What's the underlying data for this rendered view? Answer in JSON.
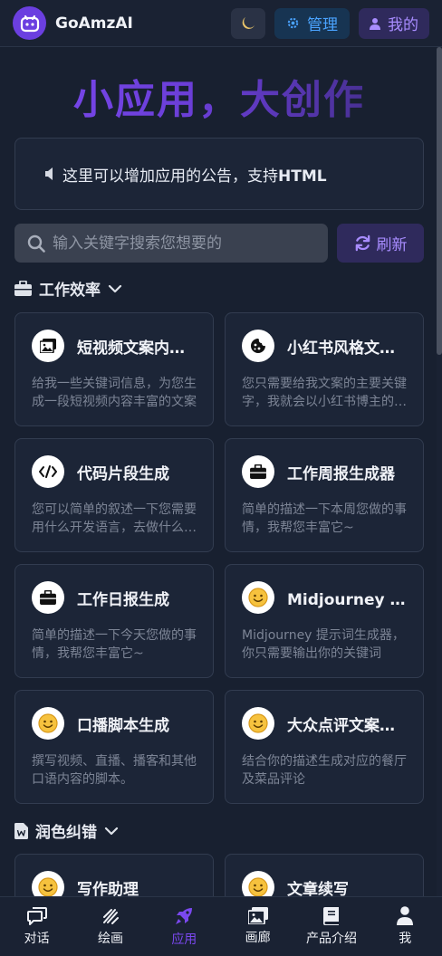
{
  "header": {
    "brand": "GoAmzAI",
    "admin_label": "管理",
    "me_label": "我的"
  },
  "hero_title": "小应用，大创作",
  "notice": {
    "text": "这里可以增加应用的公告，支持",
    "emphasis": "HTML"
  },
  "search": {
    "placeholder": "输入关键字搜索您想要的"
  },
  "refresh_label": "刷新",
  "sections": [
    {
      "title": "工作效率",
      "apps": [
        {
          "title": "短视频文案内容生成",
          "desc": "给我一些关键词信息，为您生成一段短视频内容丰富的文案",
          "icon": "image-icon"
        },
        {
          "title": "小红书风格文案生成",
          "desc": "您只需要给我文案的主要关键字，我就会以小红书博主的风格为您生成",
          "icon": "cookie-icon"
        },
        {
          "title": "代码片段生成",
          "desc": "您可以简单的叙述一下您需要用什么开发语言，去做什么事情",
          "icon": "code-icon"
        },
        {
          "title": "工作周报生成器",
          "desc": "简单的描述一下本周您做的事情，我帮您丰富它~",
          "icon": "briefcase-icon"
        },
        {
          "title": "工作日报生成",
          "desc": "简单的描述一下今天您做的事情，我帮您丰富它~",
          "icon": "briefcase-icon"
        },
        {
          "title": "Midjourney 提示词生成器",
          "desc": "Midjourney 提示词生成器，你只需要输出你的关键词",
          "icon": "smile-icon"
        },
        {
          "title": "口播脚本生成",
          "desc": "撰写视频、直播、播客和其他口语内容的脚本。",
          "icon": "smile-icon"
        },
        {
          "title": "大众点评文案生成",
          "desc": "结合你的描述生成对应的餐厅及菜品评论",
          "icon": "smile-icon"
        }
      ]
    },
    {
      "title": "润色纠错",
      "apps": [
        {
          "title": "写作助理",
          "desc": "",
          "icon": "smile-icon"
        },
        {
          "title": "文章续写",
          "desc": "",
          "icon": "smile-icon"
        }
      ]
    }
  ],
  "nav": [
    {
      "label": "对话",
      "icon": "chat-icon",
      "active": false
    },
    {
      "label": "绘画",
      "icon": "paint-icon",
      "active": false
    },
    {
      "label": "应用",
      "icon": "rocket-icon",
      "active": true
    },
    {
      "label": "画廊",
      "icon": "gallery-icon",
      "active": false
    },
    {
      "label": "产品介绍",
      "icon": "book-icon",
      "active": false
    },
    {
      "label": "我",
      "icon": "user-icon",
      "active": false
    }
  ],
  "colors": {
    "accent": "#7b48f0",
    "background": "#182030",
    "card": "#1c2537"
  }
}
